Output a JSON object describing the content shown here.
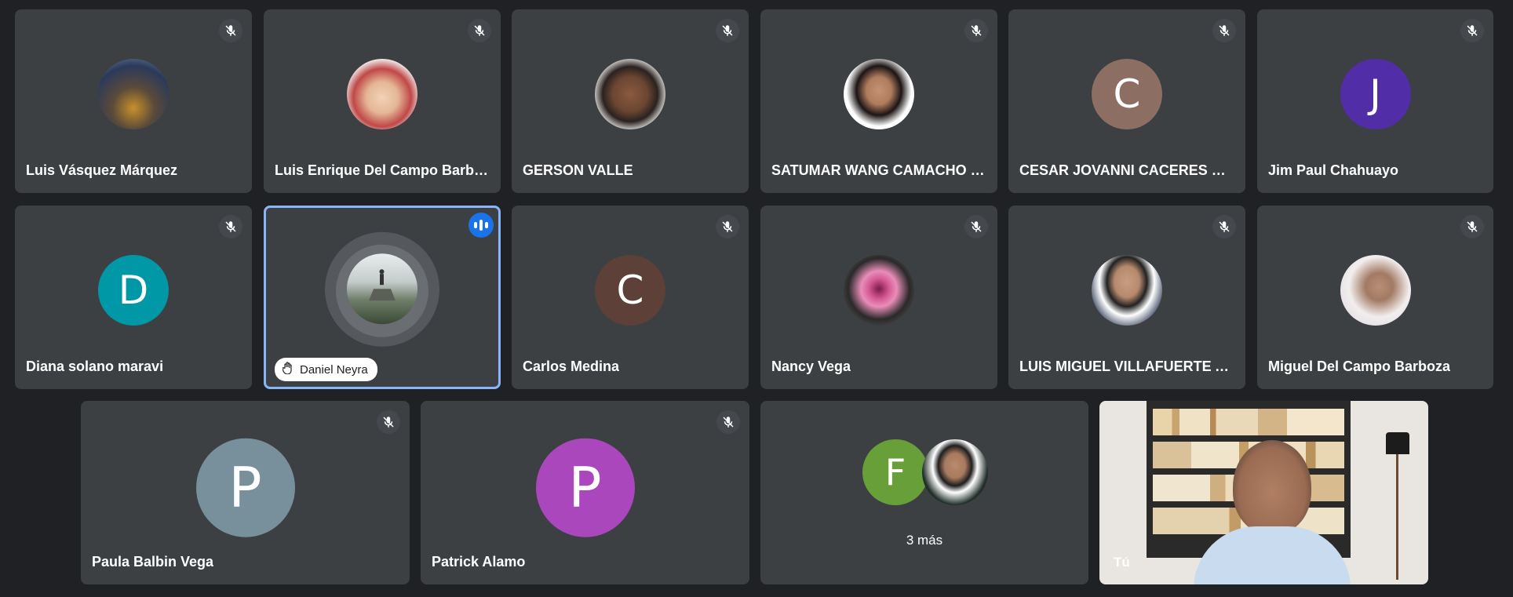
{
  "participants": [
    {
      "name": "Luis Vásquez Márquez",
      "avatar": "photo-city-night",
      "muted": true
    },
    {
      "name": "Luis Enrique Del Campo Barboza",
      "avatar": "photo-child",
      "muted": true
    },
    {
      "name": "GERSON VALLE",
      "avatar": "photo-man",
      "muted": true
    },
    {
      "name": "SATUMAR WANG CAMACHO SU...",
      "avatar": "photo-woman",
      "muted": true
    },
    {
      "name": "CESAR JOVANNI CACERES CAU...",
      "initial": "C",
      "color": "#8d6e63",
      "muted": true
    },
    {
      "name": "Jim Paul Chahuayo",
      "initial": "J",
      "color": "#512da8",
      "muted": true
    },
    {
      "name": "Diana solano maravi",
      "initial": "D",
      "color": "#0097a7",
      "muted": true
    },
    {
      "name": "Daniel Neyra",
      "avatar": "photo-landscape",
      "speaking": true,
      "hand_raised": true
    },
    {
      "name": "Carlos Medina",
      "initial": "C",
      "color": "#5d4037",
      "muted": true
    },
    {
      "name": "Nancy Vega",
      "avatar": "photo-orchid",
      "muted": true
    },
    {
      "name": "LUIS MIGUEL VILLAFUERTE AYA...",
      "avatar": "photo-man-suit",
      "muted": true
    },
    {
      "name": "Miguel Del Campo Barboza",
      "avatar": "photo-man-glasses",
      "muted": true
    },
    {
      "name": "Paula Balbin Vega",
      "initial": "P",
      "color": "#78909c",
      "muted": true
    },
    {
      "name": "Patrick Alamo",
      "initial": "P",
      "color": "#ab47bc",
      "muted": true
    }
  ],
  "overflow": {
    "initial": "F",
    "color": "#689f38",
    "label": "3 más"
  },
  "self": {
    "label": "Tú"
  },
  "colors": {
    "background": "#202124",
    "tile": "#3c4043",
    "active_border": "#8ab4f8",
    "speaking": "#1a73e8"
  }
}
